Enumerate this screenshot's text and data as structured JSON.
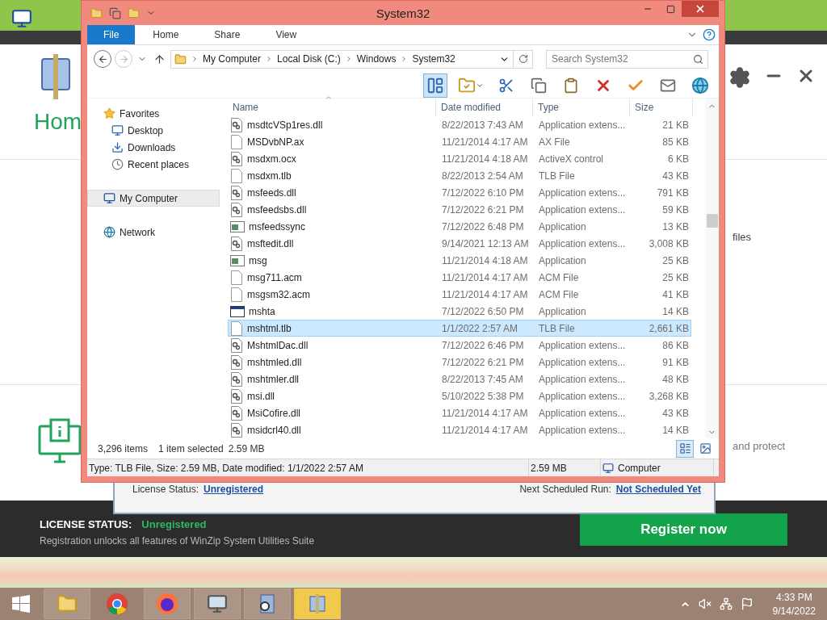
{
  "background_app": {
    "title": "Hom",
    "side_text_top": "files",
    "side_text_bottom": "and protect",
    "dialog": {
      "license_label": "License Status:",
      "license_value": "Unregistered",
      "next_run_label": "Next Scheduled Run:",
      "next_run_value": "Not Scheduled Yet"
    },
    "footer": {
      "license_label": "LICENSE STATUS:",
      "license_value": "Unregistered",
      "note": "Registration unlocks all features of WinZip System Utilities Suite",
      "button": "Register now"
    }
  },
  "explorer": {
    "title": "System32",
    "ribbon_tabs": [
      {
        "label": "File",
        "selected": true
      },
      {
        "label": "Home",
        "selected": false
      },
      {
        "label": "Share",
        "selected": false
      },
      {
        "label": "View",
        "selected": false
      }
    ],
    "breadcrumb": [
      "My Computer",
      "Local Disk (C:)",
      "Windows",
      "System32"
    ],
    "search": {
      "placeholder": "Search System32"
    },
    "navigation": [
      {
        "label": "Favorites",
        "kind": "favorites",
        "selected": false,
        "children": [
          {
            "label": "Desktop",
            "kind": "desktop",
            "selected": false
          },
          {
            "label": "Downloads",
            "kind": "downloads",
            "selected": false
          },
          {
            "label": "Recent places",
            "kind": "recent",
            "selected": false
          }
        ]
      },
      {
        "label": "My Computer",
        "kind": "computer",
        "selected": true
      },
      {
        "label": "Network",
        "kind": "network",
        "selected": false
      }
    ],
    "columns": [
      "Name",
      "Date modified",
      "Type",
      "Size"
    ],
    "files": [
      {
        "name": "msdtcVSp1res.dll",
        "date": "8/22/2013 7:43 AM",
        "type": "Application extens...",
        "size": "21 KB",
        "kind": "dll",
        "selected": false
      },
      {
        "name": "MSDvbNP.ax",
        "date": "11/21/2014 4:17 AM",
        "type": "AX File",
        "size": "85 KB",
        "kind": "blank",
        "selected": false
      },
      {
        "name": "msdxm.ocx",
        "date": "11/21/2014 4:18 AM",
        "type": "ActiveX control",
        "size": "6 KB",
        "kind": "dll",
        "selected": false
      },
      {
        "name": "msdxm.tlb",
        "date": "8/22/2013 2:54 AM",
        "type": "TLB File",
        "size": "43 KB",
        "kind": "blank",
        "selected": false
      },
      {
        "name": "msfeeds.dll",
        "date": "7/12/2022 6:10 PM",
        "type": "Application extens...",
        "size": "791 KB",
        "kind": "dll",
        "selected": false
      },
      {
        "name": "msfeedsbs.dll",
        "date": "7/12/2022 6:21 PM",
        "type": "Application extens...",
        "size": "59 KB",
        "kind": "dll",
        "selected": false
      },
      {
        "name": "msfeedssync",
        "date": "7/12/2022 6:48 PM",
        "type": "Application",
        "size": "13 KB",
        "kind": "app",
        "selected": false
      },
      {
        "name": "msftedit.dll",
        "date": "9/14/2021 12:13 AM",
        "type": "Application extens...",
        "size": "3,008 KB",
        "kind": "dll",
        "selected": false
      },
      {
        "name": "msg",
        "date": "11/21/2014 4:18 AM",
        "type": "Application",
        "size": "25 KB",
        "kind": "app",
        "selected": false
      },
      {
        "name": "msg711.acm",
        "date": "11/21/2014 4:17 AM",
        "type": "ACM File",
        "size": "25 KB",
        "kind": "blank",
        "selected": false
      },
      {
        "name": "msgsm32.acm",
        "date": "11/21/2014 4:17 AM",
        "type": "ACM File",
        "size": "41 KB",
        "kind": "blank",
        "selected": false
      },
      {
        "name": "mshta",
        "date": "7/12/2022 6:50 PM",
        "type": "Application",
        "size": "14 KB",
        "kind": "window",
        "selected": false
      },
      {
        "name": "mshtml.tlb",
        "date": "1/1/2022 2:57 AM",
        "type": "TLB File",
        "size": "2,661 KB",
        "kind": "blank",
        "selected": true
      },
      {
        "name": "MshtmlDac.dll",
        "date": "7/12/2022 6:46 PM",
        "type": "Application extens...",
        "size": "86 KB",
        "kind": "dll",
        "selected": false
      },
      {
        "name": "mshtmled.dll",
        "date": "7/12/2022 6:21 PM",
        "type": "Application extens...",
        "size": "91 KB",
        "kind": "dll",
        "selected": false
      },
      {
        "name": "mshtmler.dll",
        "date": "8/22/2013 7:45 AM",
        "type": "Application extens...",
        "size": "48 KB",
        "kind": "dll",
        "selected": false
      },
      {
        "name": "msi.dll",
        "date": "5/10/2022 5:38 PM",
        "type": "Application extens...",
        "size": "3,268 KB",
        "kind": "dll",
        "selected": false
      },
      {
        "name": "MsiCofire.dll",
        "date": "11/21/2014 4:17 AM",
        "type": "Application extens...",
        "size": "43 KB",
        "kind": "dll",
        "selected": false
      },
      {
        "name": "msidcrl40.dll",
        "date": "11/21/2014 4:17 AM",
        "type": "Application extens...",
        "size": "14 KB",
        "kind": "dll",
        "selected": false
      }
    ],
    "item_count": "3,296 items",
    "selection_info": "1 item selected",
    "selection_size": "2.59 MB",
    "details": "Type: TLB File, Size: 2.59 MB, Date modified: 1/1/2022 2:57 AM",
    "details_size": "2.59 MB",
    "location": "Computer"
  },
  "taskbar": {
    "apps": [
      {
        "kind": "explorer",
        "selected": false
      },
      {
        "kind": "chrome",
        "selected": false
      },
      {
        "kind": "firefox",
        "selected": false
      },
      {
        "kind": "monitor",
        "selected": false
      },
      {
        "kind": "zip-search",
        "selected": false
      },
      {
        "kind": "zip",
        "selected": true
      }
    ],
    "time": "4:33 PM",
    "date": "9/14/2022"
  }
}
